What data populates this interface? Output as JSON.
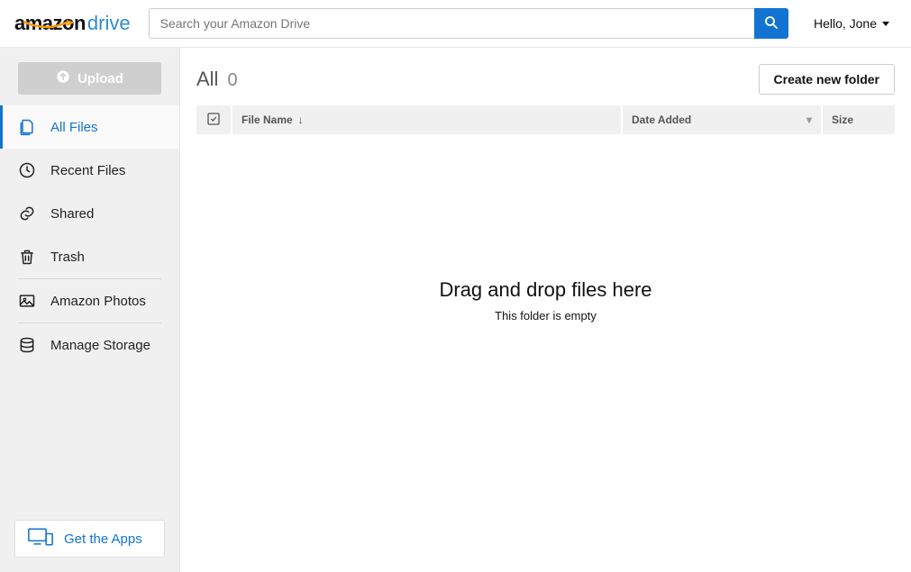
{
  "header": {
    "logo_amazon": "amazon",
    "logo_drive": "drive",
    "search_placeholder": "Search your Amazon Drive",
    "user_greeting": "Hello, Jone"
  },
  "sidebar": {
    "upload_label": "Upload",
    "items": [
      {
        "label": "All Files",
        "active": true
      },
      {
        "label": "Recent Files",
        "active": false
      },
      {
        "label": "Shared",
        "active": false
      },
      {
        "label": "Trash",
        "active": false
      }
    ],
    "secondary": [
      {
        "label": "Amazon Photos"
      },
      {
        "label": "Manage Storage"
      }
    ],
    "apps_label": "Get the Apps"
  },
  "main": {
    "title": "All",
    "count": "0",
    "create_folder_label": "Create new folder",
    "columns": {
      "filename": "File Name",
      "date": "Date Added",
      "size": "Size"
    },
    "empty": {
      "title": "Drag and drop files here",
      "subtitle": "This folder is empty"
    }
  }
}
